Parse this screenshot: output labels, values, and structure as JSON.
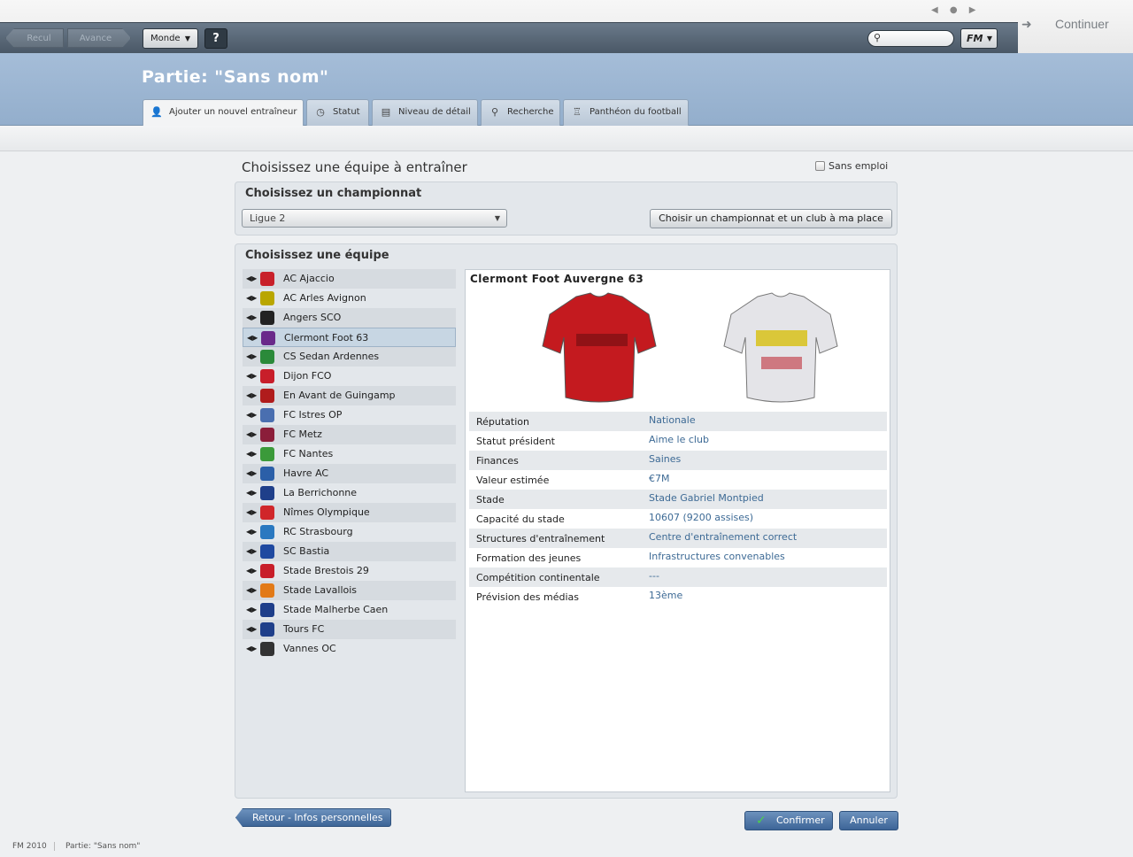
{
  "toolbar": {
    "back_label": "Recul",
    "forward_label": "Avance",
    "world_label": "Monde",
    "help_label": "?",
    "fm_label": "FM",
    "continue_label": "Continuer"
  },
  "header": {
    "title": "Partie: \"Sans nom\"",
    "tabs": [
      {
        "label": "Ajouter un nouvel entraîneur",
        "icon": "coach-icon",
        "active": true
      },
      {
        "label": "Statut",
        "icon": "clock-icon"
      },
      {
        "label": "Niveau de détail",
        "icon": "note-icon"
      },
      {
        "label": "Recherche",
        "icon": "search-icon"
      },
      {
        "label": "Panthéon du football",
        "icon": "trophy-icon"
      }
    ]
  },
  "main": {
    "title": "Choisissez une équipe à entraîner",
    "unemployed_label": "Sans emploi",
    "league_panel": {
      "title": "Choisissez un championnat",
      "selected_league": "Ligue 2",
      "random_button": "Choisir un championnat et un club à ma place"
    },
    "team_panel": {
      "title": "Choisissez une équipe",
      "teams": [
        {
          "name": "AC Ajaccio",
          "color": "#c8202a"
        },
        {
          "name": "AC Arles Avignon",
          "color": "#b9a600"
        },
        {
          "name": "Angers SCO",
          "color": "#222222"
        },
        {
          "name": "Clermont Foot 63",
          "color": "#6a2a8a",
          "selected": true
        },
        {
          "name": "CS Sedan Ardennes",
          "color": "#2b8a3a"
        },
        {
          "name": "Dijon FCO",
          "color": "#c81e2a"
        },
        {
          "name": "En Avant de Guingamp",
          "color": "#b01c1c"
        },
        {
          "name": "FC Istres OP",
          "color": "#4a6fb0"
        },
        {
          "name": "FC Metz",
          "color": "#8b1e3a"
        },
        {
          "name": "FC Nantes",
          "color": "#3b9a3a"
        },
        {
          "name": "Havre AC",
          "color": "#2b5fa8"
        },
        {
          "name": "La Berrichonne",
          "color": "#1f3f8a"
        },
        {
          "name": "Nîmes Olympique",
          "color": "#d0262a"
        },
        {
          "name": "RC Strasbourg",
          "color": "#2a78c0"
        },
        {
          "name": "SC Bastia",
          "color": "#1f49a0"
        },
        {
          "name": "Stade Brestois 29",
          "color": "#c81e2a"
        },
        {
          "name": "Stade Lavallois",
          "color": "#e27a18"
        },
        {
          "name": "Stade Malherbe Caen",
          "color": "#1f3f8a"
        },
        {
          "name": "Tours FC",
          "color": "#1f3f8a"
        },
        {
          "name": "Vannes OC",
          "color": "#333333"
        }
      ],
      "detail": {
        "club_name": "Clermont Foot Auvergne 63",
        "home_kit_color": "#c41a1f",
        "away_kit_color": "#e4e4e8",
        "properties": [
          {
            "key": "Réputation",
            "value": "Nationale"
          },
          {
            "key": "Statut président",
            "value": "Aime le club"
          },
          {
            "key": "Finances",
            "value": "Saines"
          },
          {
            "key": "Valeur estimée",
            "value": "€7M"
          },
          {
            "key": "Stade",
            "value": "Stade Gabriel Montpied"
          },
          {
            "key": "Capacité du stade",
            "value": "10607 (9200 assises)"
          },
          {
            "key": "Structures d'entraînement",
            "value": "Centre d'entraînement correct"
          },
          {
            "key": "Formation des jeunes",
            "value": "Infrastructures convenables"
          },
          {
            "key": "Compétition continentale",
            "value": "---"
          },
          {
            "key": "Prévision des médias",
            "value": "13ème"
          }
        ]
      }
    }
  },
  "footer": {
    "back_button": "Retour - Infos personnelles",
    "confirm_button": "Confirmer",
    "cancel_button": "Annuler"
  },
  "statusbar": {
    "app": "FM 2010",
    "game": "Partie: \"Sans nom\""
  }
}
